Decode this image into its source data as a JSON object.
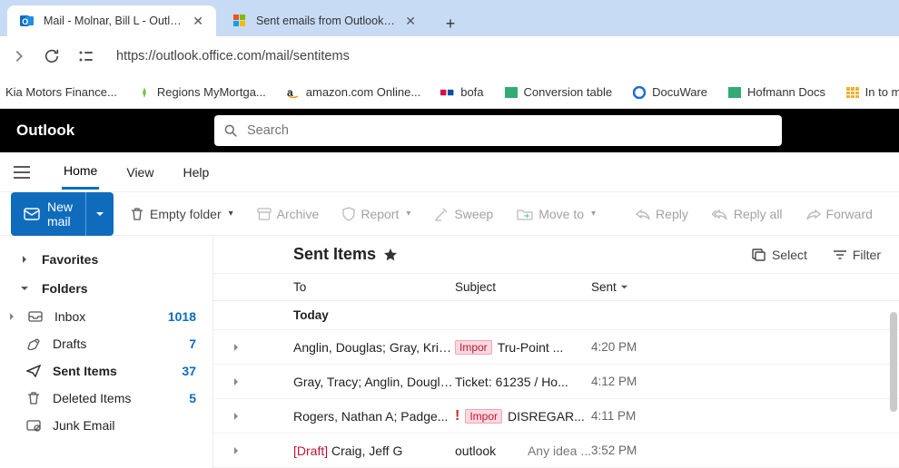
{
  "browser": {
    "tabs": [
      {
        "title": "Mail - Molnar, Bill L - Outlook",
        "favicon": "outlook"
      },
      {
        "title": "Sent emails from Outlook are r...",
        "favicon": "ms"
      }
    ],
    "url": "https://outlook.office.com/mail/sentitems"
  },
  "bookmarks": [
    {
      "label": "Kia Motors Finance...",
      "icon": "page"
    },
    {
      "label": "Regions MyMortga...",
      "icon": "regions"
    },
    {
      "label": "amazon.com Online...",
      "icon": "amazon"
    },
    {
      "label": "bofa",
      "icon": "bofa"
    },
    {
      "label": "Conversion table",
      "icon": "conv"
    },
    {
      "label": "DocuWare",
      "icon": "docuware"
    },
    {
      "label": "Hofmann Docs",
      "icon": "hofmann"
    },
    {
      "label": "In to mm (inches to...",
      "icon": "intomm"
    }
  ],
  "app": {
    "brand": "Outlook",
    "search_placeholder": "Search"
  },
  "view_tabs": {
    "home": "Home",
    "view": "View",
    "help": "Help"
  },
  "ribbon": {
    "new_mail": "New mail",
    "empty_folder": "Empty folder",
    "archive": "Archive",
    "report": "Report",
    "sweep": "Sweep",
    "move_to": "Move to",
    "reply": "Reply",
    "reply_all": "Reply all",
    "forward": "Forward"
  },
  "sidebar": {
    "favorites": "Favorites",
    "folders": "Folders",
    "items": {
      "inbox": {
        "label": "Inbox",
        "count": "1018"
      },
      "drafts": {
        "label": "Drafts",
        "count": "7"
      },
      "sent": {
        "label": "Sent Items",
        "count": "37"
      },
      "deleted": {
        "label": "Deleted Items",
        "count": "5"
      },
      "junk": {
        "label": "Junk Email",
        "count": ""
      }
    }
  },
  "list": {
    "title": "Sent Items",
    "select": "Select",
    "filter": "Filter",
    "cols": {
      "to": "To",
      "subject": "Subject",
      "sent": "Sent"
    },
    "group": "Today",
    "rows": [
      {
        "to": "Anglin, Douglas; Gray, Kristop...",
        "tag": "Impor",
        "imp": "",
        "subject": "Tru-Point ...",
        "preview": "",
        "sent": "4:20 PM",
        "draft": ""
      },
      {
        "to": "Gray, Tracy; Anglin, Douglas; J...",
        "tag": "",
        "imp": "",
        "subject": "Ticket: 61235 / Ho...",
        "preview": "",
        "sent": "4:12 PM",
        "draft": ""
      },
      {
        "to": "Rogers, Nathan A; Padge...",
        "tag": "Impor",
        "imp": "!",
        "subject": "DISREGAR...",
        "preview": "",
        "sent": "4:11 PM",
        "draft": ""
      },
      {
        "to": "Craig, Jeff G",
        "tag": "",
        "imp": "",
        "subject": "outlook",
        "preview": "Any idea ...",
        "sent": "3:52 PM",
        "draft": "[Draft] "
      }
    ]
  }
}
